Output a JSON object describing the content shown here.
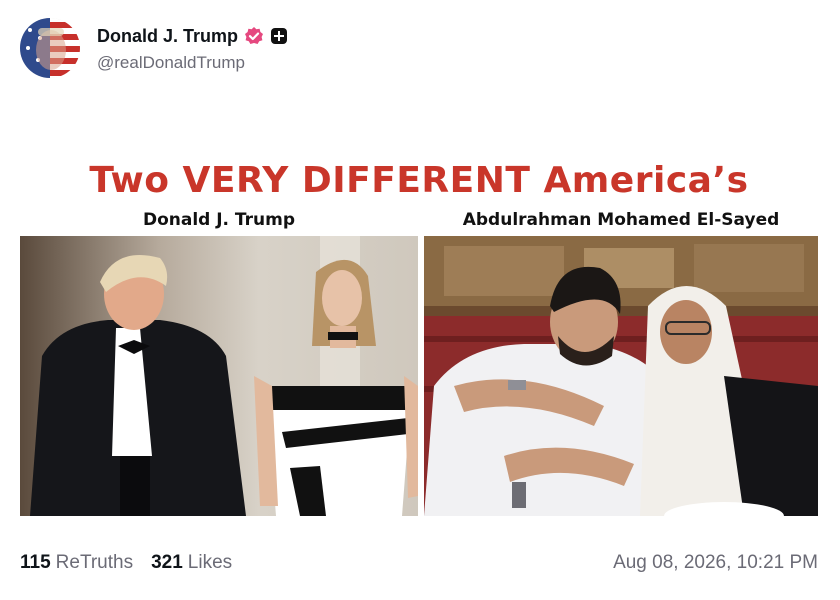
{
  "post": {
    "display_name": "Donald J. Trump",
    "handle": "@realDonaldTrump",
    "verified_icon": "verified-badge-icon",
    "plus_icon": "plus-badge-icon",
    "accent_color": "#e5487f"
  },
  "media": {
    "title": "Two VERY DIFFERENT America’s",
    "left_caption": "Donald J. Trump",
    "right_caption": "Abdulrahman Mohamed El-Sayed",
    "title_color": "#c9362a"
  },
  "stats": {
    "retruths_count": "115",
    "retruths_label": "ReTruths",
    "likes_count": "321",
    "likes_label": "Likes",
    "timestamp": "Aug 08, 2026, 10:21 PM"
  }
}
